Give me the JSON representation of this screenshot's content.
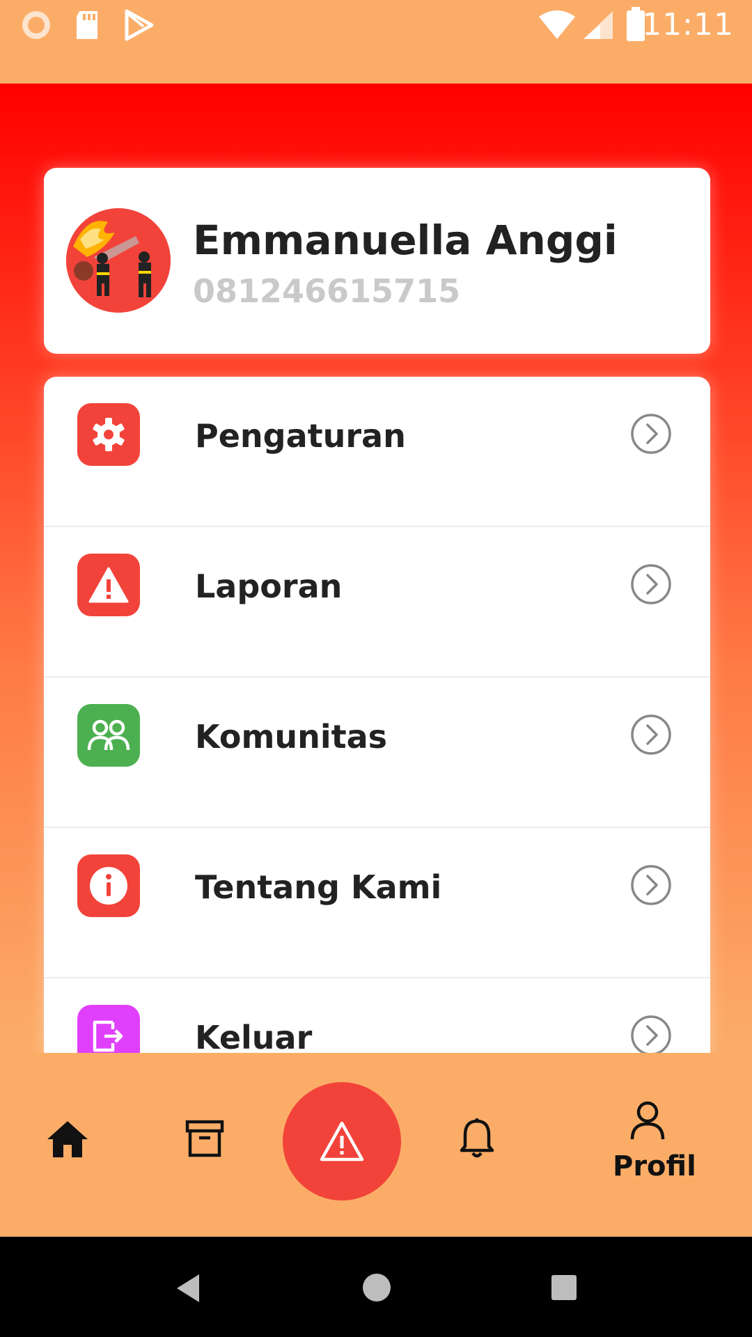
{
  "status_bar": {
    "time": "11:11",
    "icons": [
      "loading-icon",
      "sd-card-icon",
      "play-store-icon",
      "wifi-icon",
      "signal-icon",
      "battery-icon"
    ]
  },
  "profile": {
    "name": "Emmanuella Anggi",
    "phone": "081246615715",
    "avatar": "firefighter-avatar"
  },
  "menu": {
    "items": [
      {
        "label": "Pengaturan",
        "icon": "gear-icon",
        "color": "#F2433A"
      },
      {
        "label": "Laporan",
        "icon": "warning-icon",
        "color": "#F2433A"
      },
      {
        "label": "Komunitas",
        "icon": "community-icon",
        "color": "#4CAF50"
      },
      {
        "label": "Tentang Kami",
        "icon": "info-icon",
        "color": "#F2433A"
      },
      {
        "label": "Keluar",
        "icon": "logout-icon",
        "color": "#E040FB"
      }
    ]
  },
  "bottom_nav": {
    "items": [
      {
        "name": "home",
        "icon": "home-icon"
      },
      {
        "name": "archive",
        "icon": "archive-icon"
      },
      {
        "name": "report",
        "icon": "warning-icon"
      },
      {
        "name": "notifications",
        "icon": "bell-icon"
      },
      {
        "name": "profile",
        "icon": "user-icon",
        "label": "Profil"
      }
    ]
  },
  "colors": {
    "accent": "#F2433A",
    "header_top": "#FF0000",
    "background": "#FBAD68"
  }
}
